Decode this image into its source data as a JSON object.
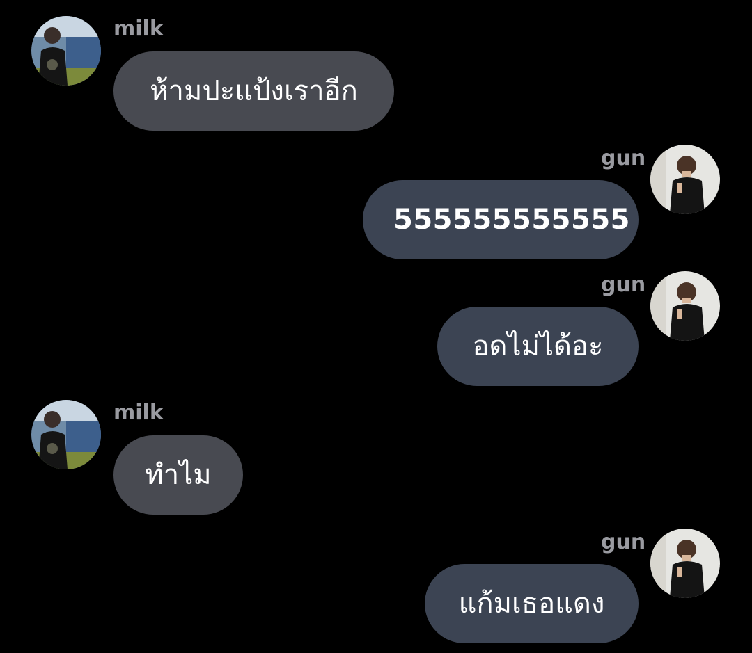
{
  "theme": {
    "background": "#000000",
    "bubble_left": "#484a51",
    "bubble_right": "#3c4453",
    "name_color": "#9a9ba1",
    "text_color": "#ffffff"
  },
  "messages": [
    {
      "sender": "milk",
      "side": "left",
      "text": "ห้ามปะแป้งเราอีก",
      "avatar_icon": "milk-avatar"
    },
    {
      "sender": "gun",
      "side": "right",
      "text": "555555555555",
      "avatar_icon": "gun-avatar"
    },
    {
      "sender": "gun",
      "side": "right",
      "text": "อดไม่ได้อะ",
      "avatar_icon": "gun-avatar"
    },
    {
      "sender": "milk",
      "side": "left",
      "text": "ทำไม",
      "avatar_icon": "milk-avatar"
    },
    {
      "sender": "gun",
      "side": "right",
      "text": "แก้มเธอแดง",
      "avatar_icon": "gun-avatar"
    }
  ]
}
